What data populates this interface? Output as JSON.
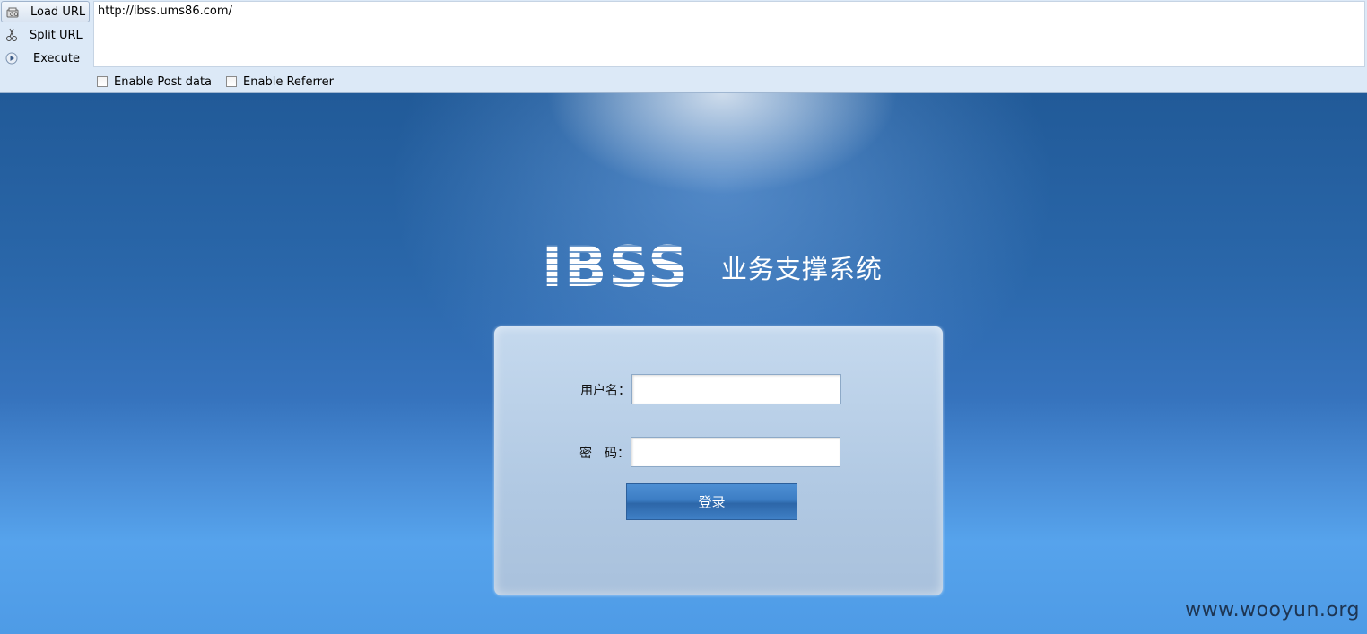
{
  "hackbar": {
    "buttons": [
      {
        "label": "Load URL",
        "icon": "load-url-icon"
      },
      {
        "label": "Split URL",
        "icon": "split-url-icon"
      },
      {
        "label": "Execute",
        "icon": "execute-icon"
      }
    ],
    "url_value": "http://ibss.ums86.com/",
    "checkboxes": [
      {
        "label": "Enable Post data",
        "checked": false
      },
      {
        "label": "Enable Referrer",
        "checked": false
      }
    ]
  },
  "page": {
    "logo": {
      "name": "IBSS",
      "subtitle": "业务支撑系统"
    },
    "login": {
      "username_label": "用户名：",
      "password_label": "密　码：",
      "username_value": "",
      "password_value": "",
      "submit_label": "登录"
    },
    "watermark": "www.wooyun.org"
  },
  "colors": {
    "toolbar_bg": "#dce9f7",
    "page_bg_top": "#215a98",
    "page_bg_bottom": "#56a3ec",
    "button_blue": "#3c7dc4"
  }
}
